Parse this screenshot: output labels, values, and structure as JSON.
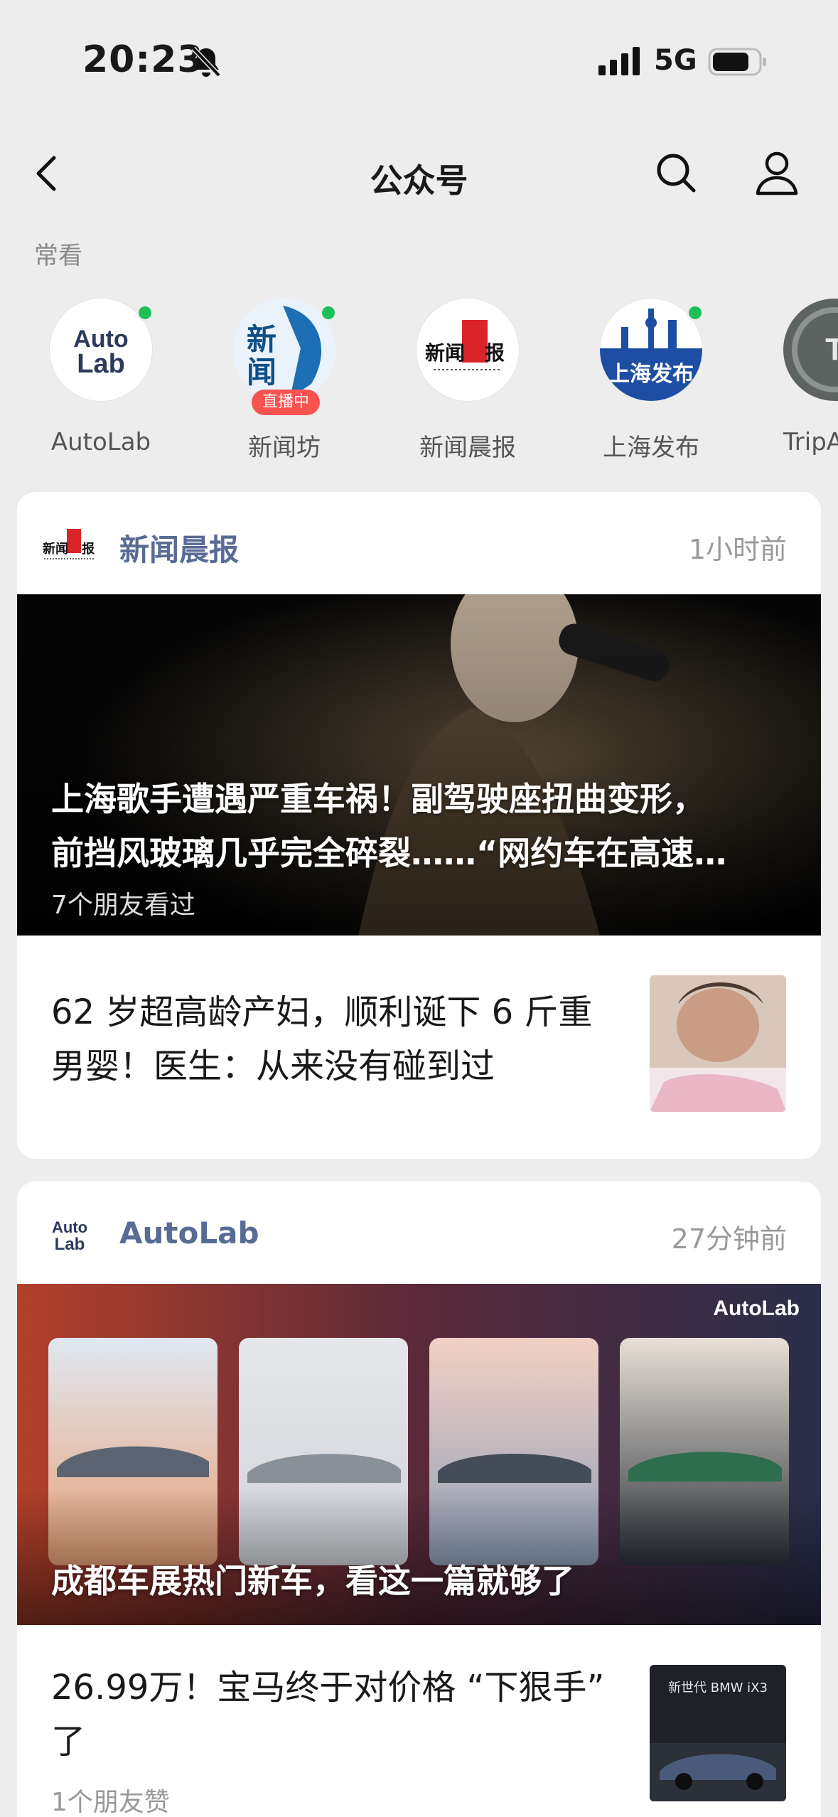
{
  "status": {
    "time": "20:23",
    "network": "5G"
  },
  "nav": {
    "title": "公众号"
  },
  "frequent": {
    "label": "常看",
    "accounts": [
      {
        "name": "AutoLab"
      },
      {
        "name": "新闻坊",
        "badge": "直播中"
      },
      {
        "name": "新闻晨报"
      },
      {
        "name": "上海发布"
      },
      {
        "name": "TripA"
      }
    ]
  },
  "cards": [
    {
      "account": "新闻晨报",
      "time": "1小时前",
      "hero": {
        "title_line1": "上海歌手遭遇严重车祸！副驾驶座扭曲变形，",
        "title_line2": "前挡风玻璃几乎完全碎裂……“网约车在高速…",
        "meta": "7个朋友看过"
      },
      "article": {
        "title": "62 岁超高龄产妇，顺利诞下 6 斤重男婴！医生：从来没有碰到过"
      }
    },
    {
      "account": "AutoLab",
      "time": "27分钟前",
      "hero": {
        "brand": "AutoLab",
        "title_line1": "成都车展热门新车，看这一篇就够了"
      },
      "article": {
        "title": "26.99万！宝马终于对价格 “下狠手” 了",
        "meta": "1个朋友赞",
        "thumb_text": "新世代 BMW iX3"
      }
    }
  ],
  "colors": {
    "link_blue": "#576b95",
    "live_red": "#fa5151",
    "online_green": "#1fbf57"
  }
}
